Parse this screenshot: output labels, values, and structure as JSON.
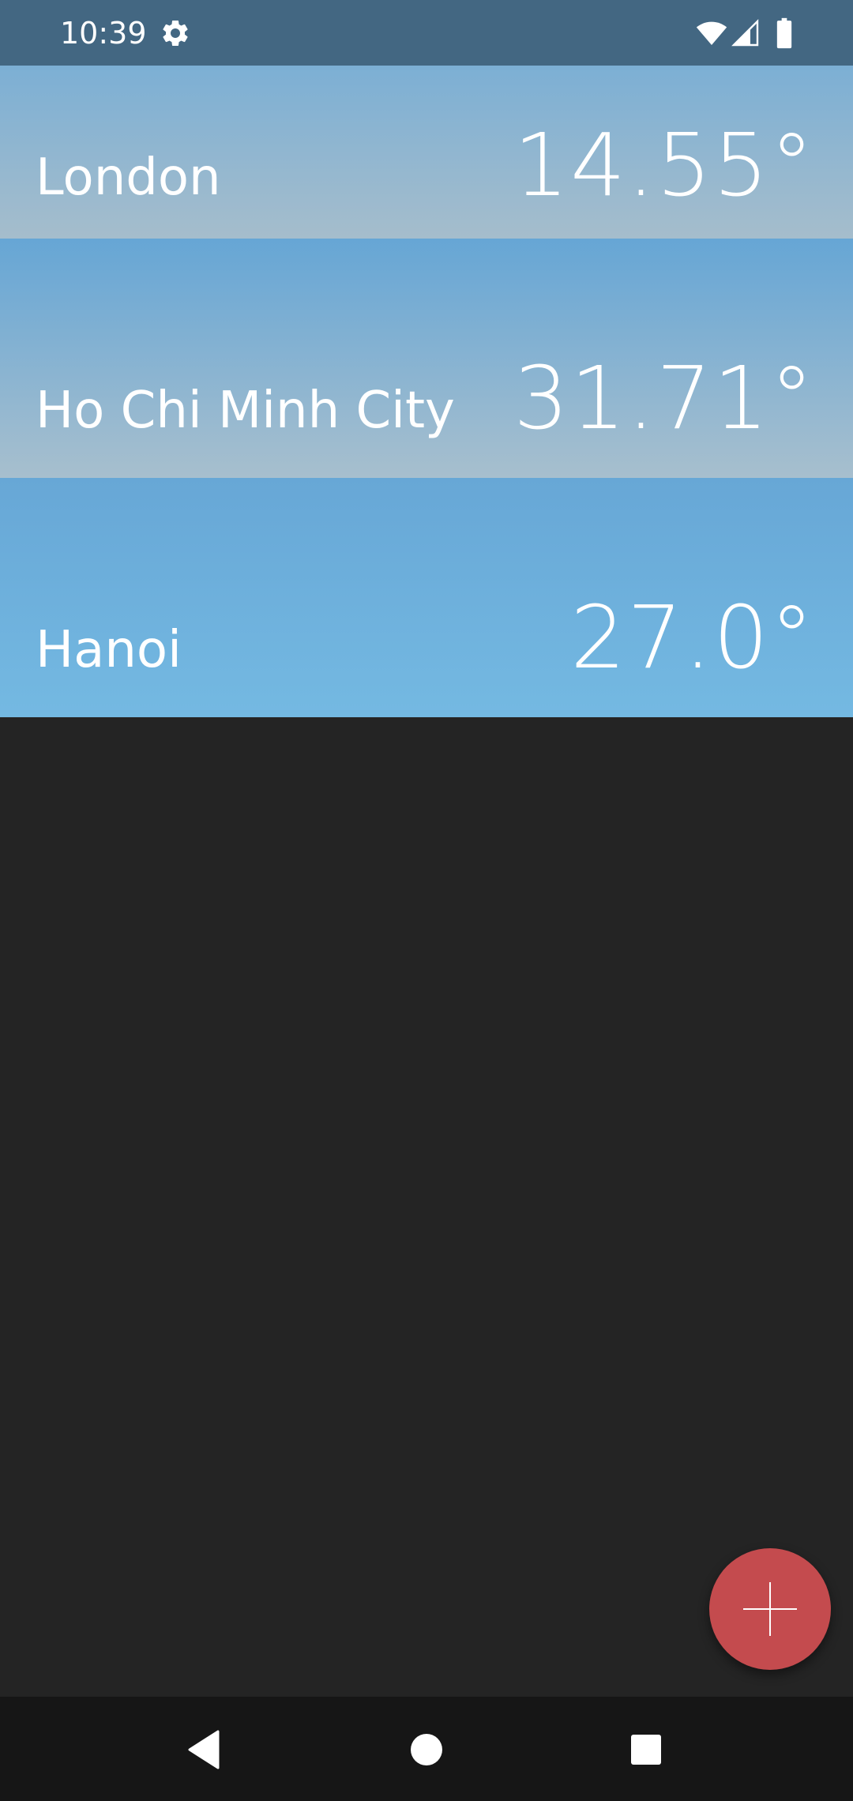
{
  "status_bar": {
    "time": "10:39",
    "icons": [
      "gear-icon",
      "wifi-icon",
      "cell-signal-icon",
      "battery-icon"
    ],
    "background": "#436782"
  },
  "cities": [
    {
      "name": "London",
      "temperature": "14.55°"
    },
    {
      "name": "Ho Chi Minh City",
      "temperature": "31.71°"
    },
    {
      "name": "Hanoi",
      "temperature": "27.0°"
    }
  ],
  "fab": {
    "icon": "plus-icon",
    "color": "#c44b4e"
  },
  "nav_bar": {
    "icons": [
      "back-icon",
      "home-icon",
      "recents-icon"
    ]
  },
  "colors": {
    "background": "#242424",
    "nav_background": "#161616"
  }
}
